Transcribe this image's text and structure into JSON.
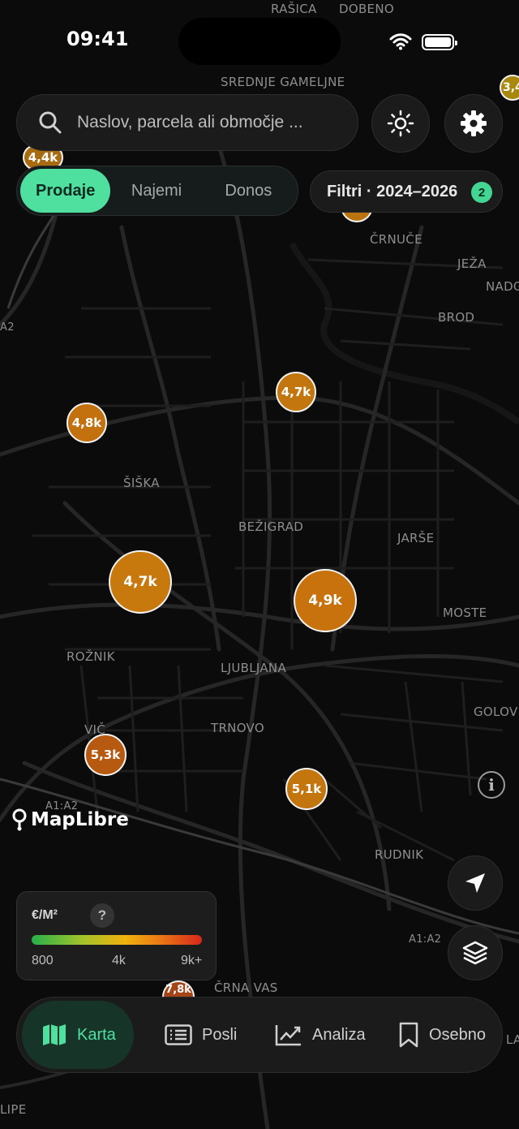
{
  "status": {
    "time": "09:41"
  },
  "search": {
    "placeholder": "Naslov, parcela ali območje ..."
  },
  "segments": {
    "items": [
      "Prodaje",
      "Najemi",
      "Donos"
    ],
    "active": "Prodaje"
  },
  "filters": {
    "label": "Filtri · 2024–2026",
    "count": "2"
  },
  "map": {
    "places": [
      "RAŠICA",
      "DOBENO",
      "SREDNJE GAMELJNE",
      "ČRNUČE",
      "JEŽA",
      "NADG",
      "BROD",
      "ŠIŠKA",
      "BEŽIGRAD",
      "JARŠE",
      "MOSTE",
      "ROŽNIK",
      "LJUBLJANA",
      "GOLOV",
      "VIČ",
      "TRNOVO",
      "RUDNIK",
      "ČRNA VAS",
      "A1:A2",
      "A1:A2",
      "A2",
      "LIPE",
      "LA"
    ],
    "clusters": [
      "4,4k",
      "3,4",
      "4,8k",
      "4,7k",
      "4,7k",
      "4,9k",
      "5,3k",
      "5,1k",
      "7,8k"
    ],
    "attribution": "MapLibre"
  },
  "legend": {
    "title": "€/M²",
    "help": "?",
    "ticks": [
      "800",
      "4k",
      "9k+"
    ]
  },
  "tabs": [
    {
      "label": "Karta",
      "icon": "map-icon"
    },
    {
      "label": "Posli",
      "icon": "list-icon"
    },
    {
      "label": "Analiza",
      "icon": "chart-icon"
    },
    {
      "label": "Osebno",
      "icon": "bookmark-icon"
    }
  ],
  "colors": {
    "accent": "#4fe0a0",
    "cluster": "#c87a0e",
    "cluster_high": "#a54416"
  }
}
